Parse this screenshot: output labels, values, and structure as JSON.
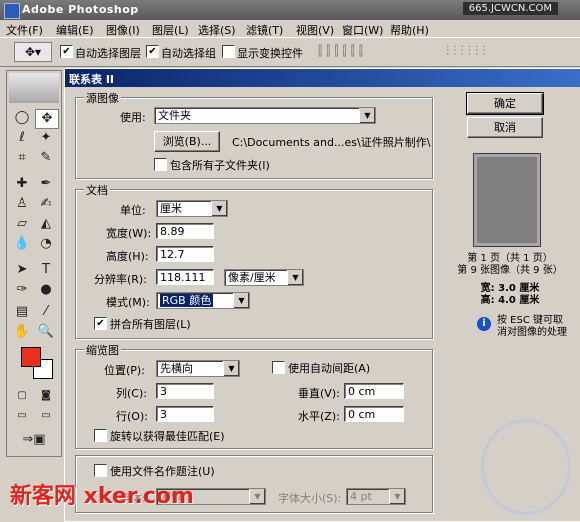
{
  "app": {
    "title": "Adobe Photoshop",
    "watermark_top": "665.JCWCN.COM"
  },
  "menu": [
    "文件(F)",
    "编辑(E)",
    "图像(I)",
    "图层(L)",
    "选择(S)",
    "滤镜(T)",
    "视图(V)",
    "窗口(W)",
    "帮助(H)"
  ],
  "options": {
    "auto_select_layer": "自动选择图层",
    "auto_select_group": "自动选择组",
    "show_transform": "显示变换控件"
  },
  "dialog": {
    "title": "联系表 II",
    "ok": "确定",
    "cancel": "取消",
    "source": {
      "group": "源图像",
      "use_label": "使用:",
      "use_value": "文件夹",
      "browse": "浏览(B)...",
      "path": "C:\\Documents and...es\\证件照片制作\\",
      "include_sub": "包含所有子文件夹(I)"
    },
    "document": {
      "group": "文档",
      "unit_label": "单位:",
      "unit_value": "厘米",
      "width_label": "宽度(W):",
      "width_value": "8.89",
      "height_label": "高度(H):",
      "height_value": "12.7",
      "res_label": "分辨率(R):",
      "res_value": "118.111",
      "res_unit": "像素/厘米",
      "mode_label": "模式(M):",
      "mode_value": "RGB 颜色",
      "flatten": "拼合所有图层(L)"
    },
    "thumbs": {
      "group": "缩览图",
      "place_label": "位置(P):",
      "place_value": "先横向",
      "auto_spacing": "使用自动间距(A)",
      "cols_label": "列(C):",
      "cols_value": "3",
      "rows_label": "行(O):",
      "rows_value": "3",
      "vert_label": "垂直(V):",
      "vert_value": "0 cm",
      "horz_label": "水平(Z):",
      "horz_value": "0 cm",
      "rotate": "旋转以获得最佳匹配(E)"
    },
    "caption": {
      "use_filename": "使用文件名作题注(U)",
      "font_label": "字体:",
      "font_value": "宋体",
      "size_label": "字体大小(S):",
      "size_value": "4 pt"
    },
    "info": {
      "page": "第 1 页（共 1 页）",
      "image": "第 9 张图像（共 9 张）",
      "w": "宽: 3.0 厘米",
      "h": "高: 4.0 厘米",
      "esc": "按 ESC 键可取消对图像的处理"
    }
  },
  "watermark_bottom": "新客网 xker.com",
  "colors": {
    "foreground": "#e8301a",
    "background": "#ffffff"
  }
}
